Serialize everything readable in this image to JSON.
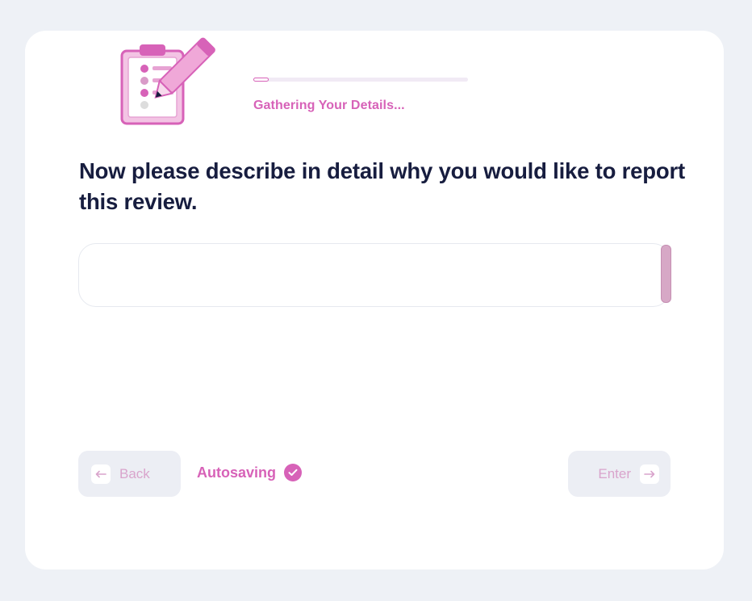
{
  "progress": {
    "status_text": "Gathering Your Details...",
    "fraction": 0.07
  },
  "question": {
    "text": "Now please describe in detail why you would like to report this review."
  },
  "answer": {
    "value": "",
    "placeholder": ""
  },
  "nav": {
    "back_label": "Back",
    "enter_label": "Enter",
    "autosave_label": "Autosaving"
  },
  "icons": {
    "illustration": "clipboard-pencil-illustration",
    "back": "arrow-left-icon",
    "enter": "arrow-right-icon",
    "autosave": "check-circle-icon"
  },
  "colors": {
    "accent": "#d762b8",
    "heading": "#171d3f",
    "button_bg": "#eceef4",
    "page_bg": "#eef1f6"
  }
}
